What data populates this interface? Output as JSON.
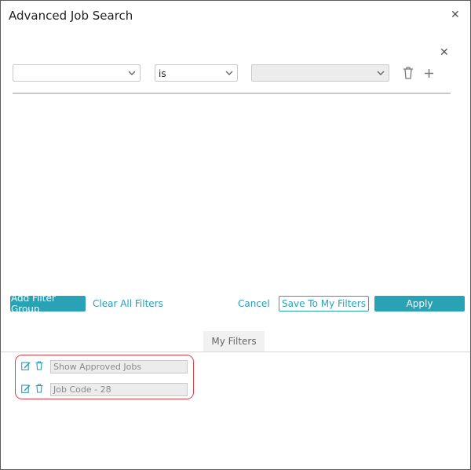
{
  "dialog": {
    "title": "Advanced Job Search",
    "close_icon": "close-icon"
  },
  "filter_row": {
    "field_value": "",
    "operator_value": "is",
    "value_value": "",
    "remove_group_icon": "close-icon",
    "delete_icon": "trash-icon",
    "add_icon": "plus-icon"
  },
  "actions": {
    "add_filter_group": "Add Filter Group",
    "clear_all_filters": "Clear All Filters",
    "cancel": "Cancel",
    "save_to_my_filters": "Save To My Filters",
    "apply": "Apply"
  },
  "my_filters": {
    "tab_label": "My Filters",
    "items": [
      {
        "name": "Show Approved Jobs",
        "edit_icon": "edit-icon",
        "delete_icon": "trash-icon"
      },
      {
        "name": "Job Code - 28",
        "edit_icon": "edit-icon",
        "delete_icon": "trash-icon"
      }
    ]
  },
  "colors": {
    "accent": "#2aa2b6",
    "highlight": "#e0404a"
  }
}
